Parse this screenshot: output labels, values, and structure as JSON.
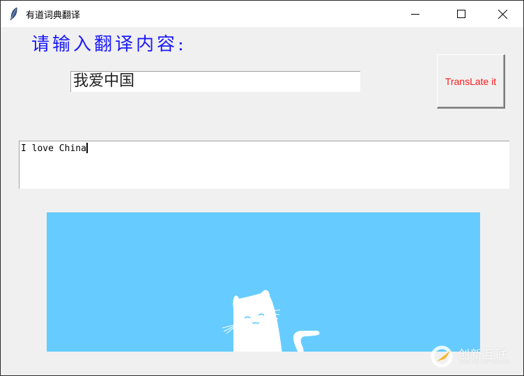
{
  "window": {
    "title": "有道词典翻译",
    "icon": "feather-icon",
    "controls": [
      "minimize-icon",
      "maximize-icon",
      "close-icon"
    ]
  },
  "main": {
    "prompt_label": "请输入翻译内容:",
    "input_value": "我爱中国",
    "translate_button_label": "TransLate it",
    "output_text": "I love China",
    "banner_image": "cat-illustration",
    "colors": {
      "prompt": "#1a1aff",
      "button_text": "#ff1a1a",
      "banner_bg": "#66ccff"
    }
  },
  "watermark": {
    "text": "创新互联",
    "subtext": "CHUANG XIN HU LIAN",
    "icon": "logo-icon"
  }
}
